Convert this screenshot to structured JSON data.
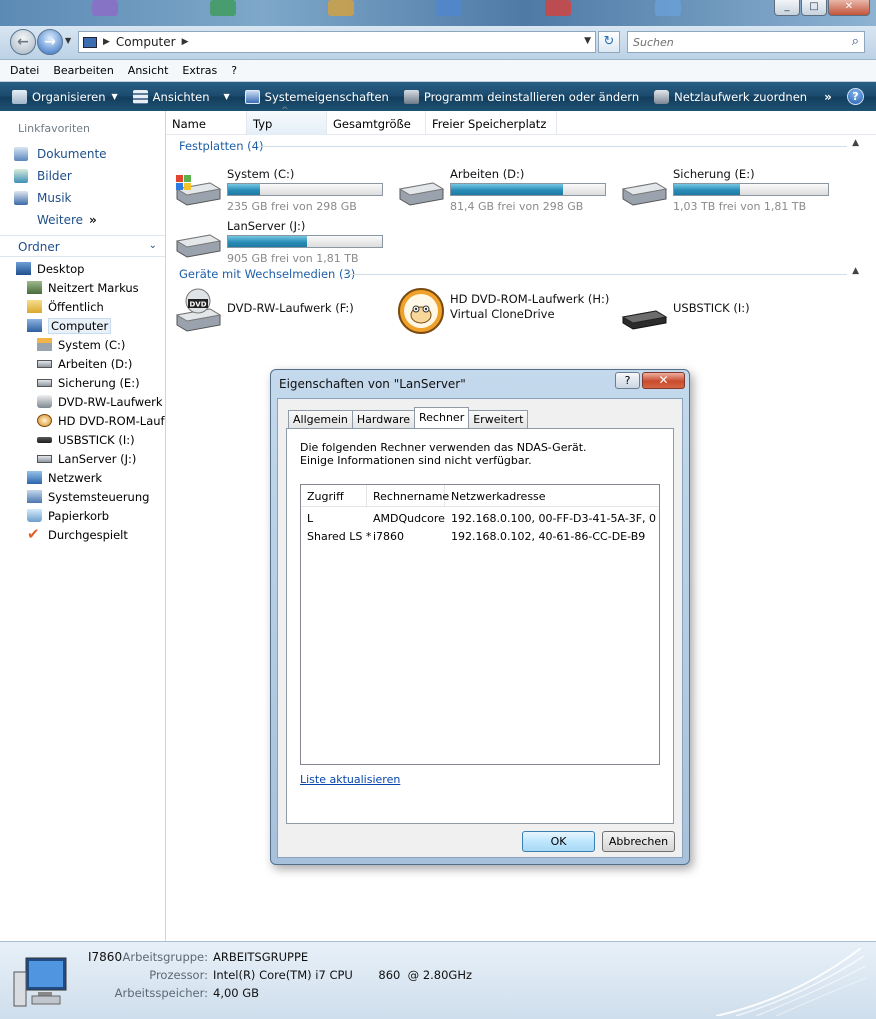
{
  "window": {
    "min": "_",
    "max": "□",
    "close": "✕"
  },
  "address": {
    "path": "Computer",
    "search_placeholder": "Suchen"
  },
  "menu": [
    "Datei",
    "Bearbeiten",
    "Ansicht",
    "Extras",
    "?"
  ],
  "commands": [
    {
      "label": "Organisieren",
      "dropdown": true,
      "icon": "organize-icon"
    },
    {
      "label": "Ansichten",
      "dropdown": true,
      "icon": "views-icon"
    },
    {
      "label": "Systemeigenschaften",
      "dropdown": false,
      "icon": "system-properties-icon"
    },
    {
      "label": "Programm deinstallieren oder ändern",
      "dropdown": false,
      "icon": "uninstall-icon"
    },
    {
      "label": "Netzlaufwerk zuordnen",
      "dropdown": false,
      "icon": "network-drive-icon"
    }
  ],
  "more": "»",
  "nav": {
    "favorites_header": "Linkfavoriten",
    "favorites": [
      "Dokumente",
      "Bilder",
      "Musik"
    ],
    "more_label": "Weitere",
    "more_arrows": "»",
    "folders_header": "Ordner",
    "tree": [
      {
        "label": "Desktop",
        "indent": 0
      },
      {
        "label": "Neitzert Markus",
        "indent": 1
      },
      {
        "label": "Öffentlich",
        "indent": 1
      },
      {
        "label": "Computer",
        "indent": 1,
        "selected": true
      },
      {
        "label": "System (C:)",
        "indent": 2
      },
      {
        "label": "Arbeiten (D:)",
        "indent": 2
      },
      {
        "label": "Sicherung (E:)",
        "indent": 2
      },
      {
        "label": "DVD-RW-Laufwerk (",
        "indent": 2
      },
      {
        "label": "HD DVD-ROM-Lauf",
        "indent": 2
      },
      {
        "label": "USBSTICK (I:)",
        "indent": 2
      },
      {
        "label": "LanServer (J:)",
        "indent": 2
      },
      {
        "label": "Netzwerk",
        "indent": 1
      },
      {
        "label": "Systemsteuerung",
        "indent": 1
      },
      {
        "label": "Papierkorb",
        "indent": 1
      },
      {
        "label": "Durchgespielt",
        "indent": 1
      }
    ]
  },
  "columns": [
    "Name",
    "Typ",
    "Gesamtgröße",
    "Freier Speicherplatz"
  ],
  "groups": {
    "hdd": "Festplatten (4)",
    "removable": "Geräte mit Wechselmedien (3)"
  },
  "drives": [
    {
      "name": "System (C:)",
      "free": "235 GB frei von 298 GB",
      "used_fraction": 0.21
    },
    {
      "name": "Arbeiten (D:)",
      "free": "81,4 GB frei von 298 GB",
      "used_fraction": 0.73
    },
    {
      "name": "Sicherung (E:)",
      "free": "1,03 TB frei von 1,81 TB",
      "used_fraction": 0.43
    },
    {
      "name": "LanServer (J:)",
      "free": "905 GB frei von 1,81 TB",
      "used_fraction": 0.51
    }
  ],
  "removable": [
    {
      "name": "DVD-RW-Laufwerk (F:)",
      "sub": ""
    },
    {
      "name": "HD DVD-ROM-Laufwerk (H:)",
      "sub": "Virtual CloneDrive"
    },
    {
      "name": "USBSTICK (I:)",
      "sub": ""
    }
  ],
  "dialog": {
    "title": "Eigenschaften von \"LanServer\"",
    "help": "?",
    "close": "✕",
    "tabs": [
      "Allgemein",
      "Hardware",
      "Rechner",
      "Erweitert"
    ],
    "active_tab": "Rechner",
    "info_line1": "Die folgenden Rechner verwenden das NDAS-Gerät.",
    "info_line2": "Einige Informationen sind nicht verfügbar.",
    "list_headers": [
      "Zugriff",
      "Rechnername",
      "Netzwerkadresse"
    ],
    "rows": [
      {
        "access": "L",
        "host": "AMDQudcore",
        "address": "192.168.0.100, 00-FF-D3-41-5A-3F, 0..."
      },
      {
        "access": "Shared LS *",
        "host": "i7860",
        "address": "192.168.0.102, 40-61-86-CC-DE-B9"
      }
    ],
    "refresh_link": "Liste aktualisieren",
    "ok": "OK",
    "cancel": "Abbrechen"
  },
  "details": {
    "pc_name": "I7860",
    "workgroup_label": "Arbeitsgruppe:",
    "workgroup_value": "ARBEITSGRUPPE",
    "cpu_label": "Prozessor:",
    "cpu_value": "Intel(R) Core(TM) i7 CPU       860  @ 2.80GHz",
    "ram_label": "Arbeitsspeicher:",
    "ram_value": "4,00 GB"
  },
  "colors": {
    "accent": "#1e5fa8",
    "cmdbar": "#1b4b6e",
    "bar_fill": "#2a8db7"
  }
}
